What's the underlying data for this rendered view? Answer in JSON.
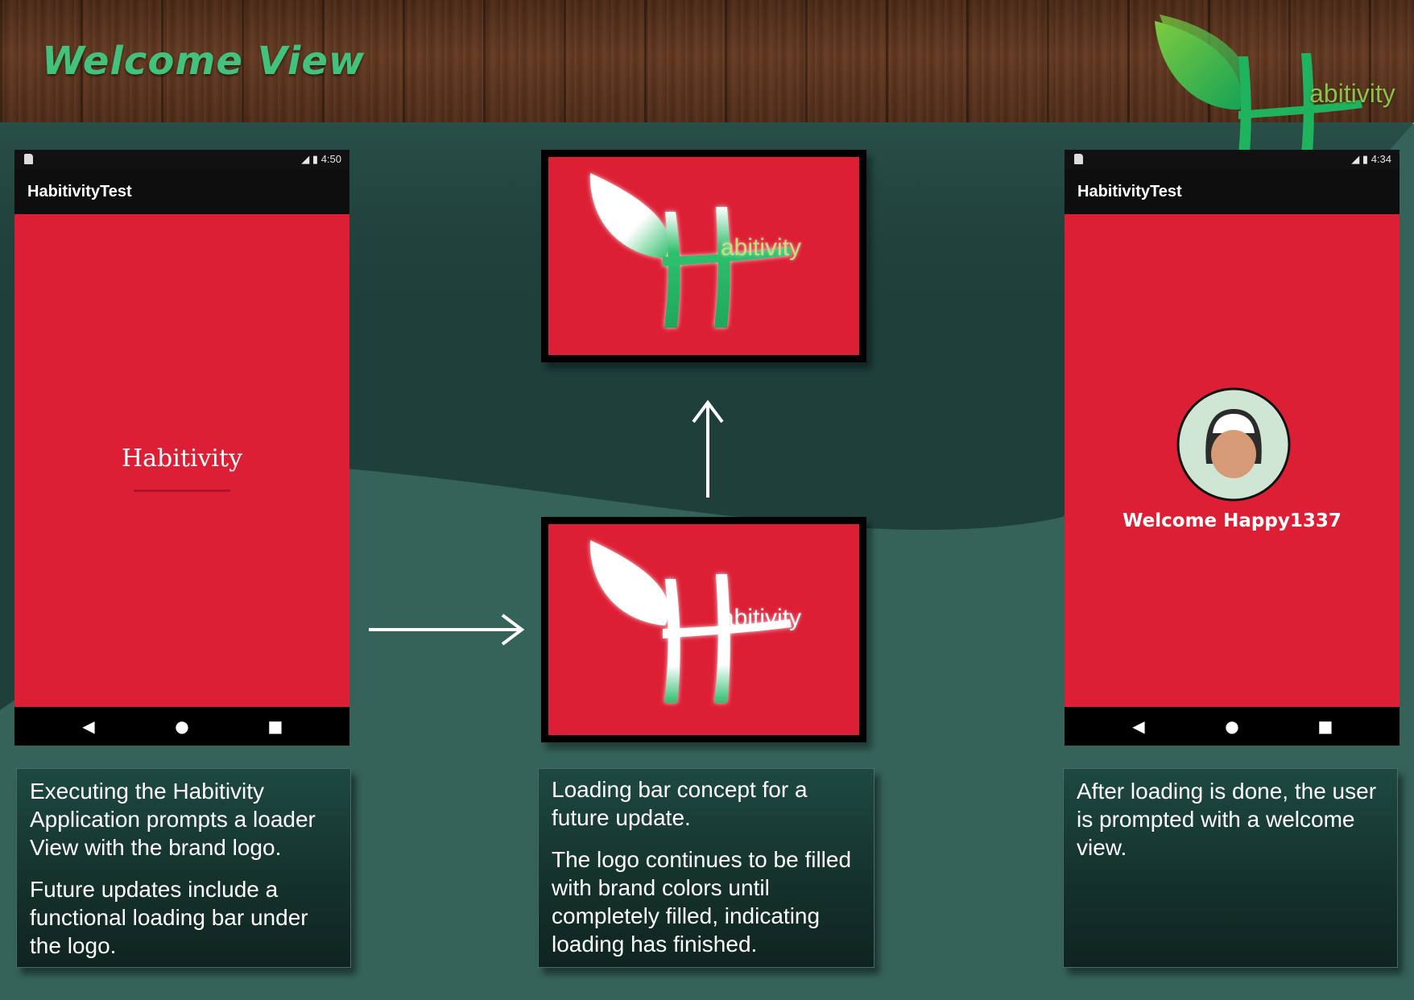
{
  "header": {
    "title": "Welcome View",
    "brand_text": "abitivity"
  },
  "phone_left": {
    "status_time": "4:50",
    "app_title": "HabitivityTest",
    "splash_text": "Habitivity"
  },
  "phone_right": {
    "status_time": "4:34",
    "app_title": "HabitivityTest",
    "welcome_text": "Welcome Happy1337"
  },
  "frame_top": {
    "logo_text": "abitivity"
  },
  "frame_bottom": {
    "logo_text": "abitivity"
  },
  "captions": {
    "left": [
      "Executing the Habitivity Application prompts a loader View with the brand logo.",
      "Future updates include a functional loading bar under the logo."
    ],
    "middle": [
      "Loading bar concept for a future update.",
      "The logo continues to be filled with brand colors until completely filled, indicating loading has finished."
    ],
    "right": [
      "After loading is done, the user is prompted with a welcome view."
    ]
  },
  "icons": {
    "nav_back": "back-triangle-icon",
    "nav_home": "home-circle-icon",
    "nav_recent": "recent-square-icon",
    "avatar": "user-avatar-icon"
  },
  "colors": {
    "brand_red": "#dc1f34",
    "brand_green": "#2fbf6d",
    "leaf_yellow_green": "#8bc34a",
    "background_teal": "#356359",
    "background_dark_teal": "#1f3f3a"
  }
}
